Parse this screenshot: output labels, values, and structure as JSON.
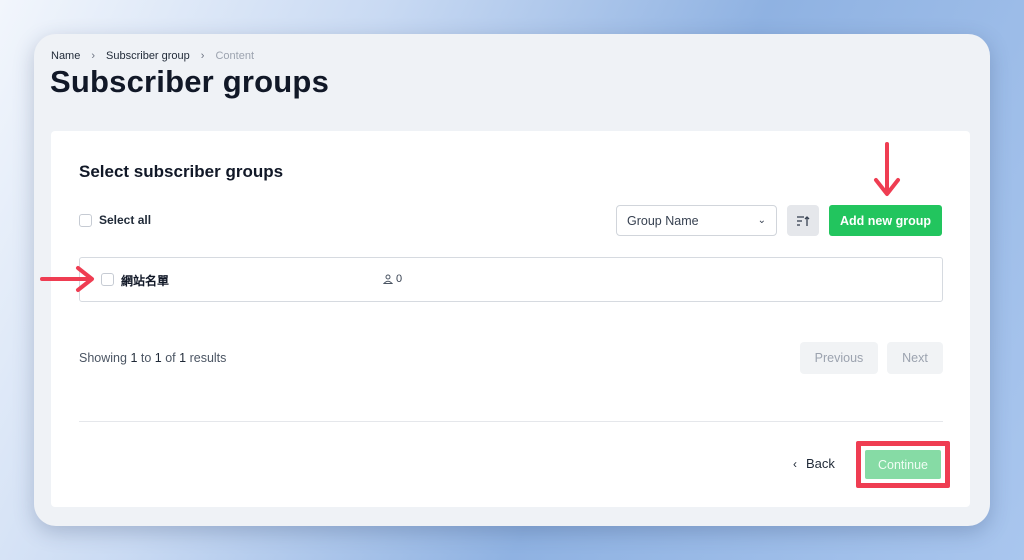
{
  "breadcrumb": {
    "items": [
      "Name",
      "Subscriber group",
      "Content"
    ]
  },
  "page": {
    "title": "Subscriber groups"
  },
  "card": {
    "title": "Select subscriber groups",
    "select_all_label": "Select all",
    "sort_select_value": "Group Name",
    "add_button_label": "Add new group"
  },
  "groups": [
    {
      "name": "網站名單",
      "members": "0"
    }
  ],
  "pagination": {
    "prefix": "Showing",
    "from": "1",
    "to_word": "to",
    "to": "1",
    "of_word": "of",
    "total": "1",
    "suffix": "results",
    "previous_label": "Previous",
    "next_label": "Next"
  },
  "footer": {
    "back_label": "Back",
    "continue_label": "Continue"
  },
  "colors": {
    "accent_green": "#22c55e",
    "continue_disabled": "#86dba5",
    "annotation_red": "#ef3d52"
  },
  "icons": [
    "chevron-right-icon",
    "chevron-down-icon",
    "sort-icon",
    "user-icon",
    "chevron-left-icon",
    "annotation-arrow"
  ]
}
